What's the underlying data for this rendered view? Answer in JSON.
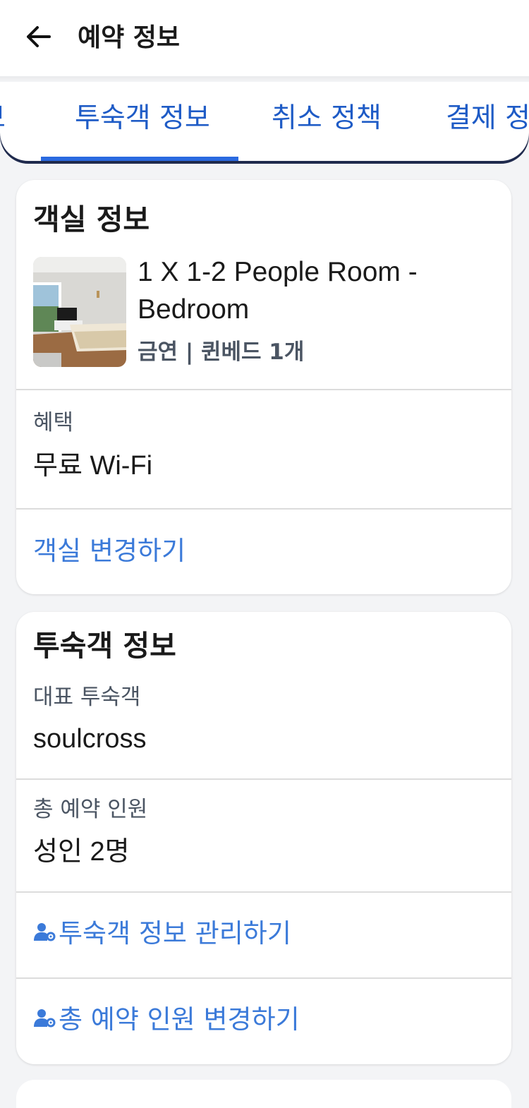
{
  "header": {
    "title": "예약 정보"
  },
  "tabs": [
    {
      "label": "보",
      "selected": false
    },
    {
      "label": "투숙객 정보",
      "selected": true
    },
    {
      "label": "취소 정책",
      "selected": false
    },
    {
      "label": "결제 정보",
      "selected": false
    }
  ],
  "room_card": {
    "title": "객실 정보",
    "room_name": "1 X 1-2 People Room - Bedroom",
    "room_meta": "금연 | 퀸베드 1개",
    "benefit_label": "혜택",
    "benefit_value": "무료 Wi-Fi",
    "change_room_link": "객실 변경하기"
  },
  "guest_card": {
    "title": "투숙객 정보",
    "main_guest_label": "대표 투숙객",
    "main_guest_value": "soulcross",
    "total_guests_label": "총 예약 인원",
    "total_guests_value": "성인 2명",
    "manage_guests_link": "투숙객 정보 관리하기",
    "change_guests_link": "총 예약 인원 변경하기"
  },
  "colors": {
    "accent": "#3b7ad9",
    "tab_text": "#1e5bc6",
    "tab_indicator": "#2b6ae0",
    "background": "#f3f4f6"
  },
  "icons": {
    "back": "arrow-left-icon",
    "guest_manage": "person-gear-icon"
  }
}
